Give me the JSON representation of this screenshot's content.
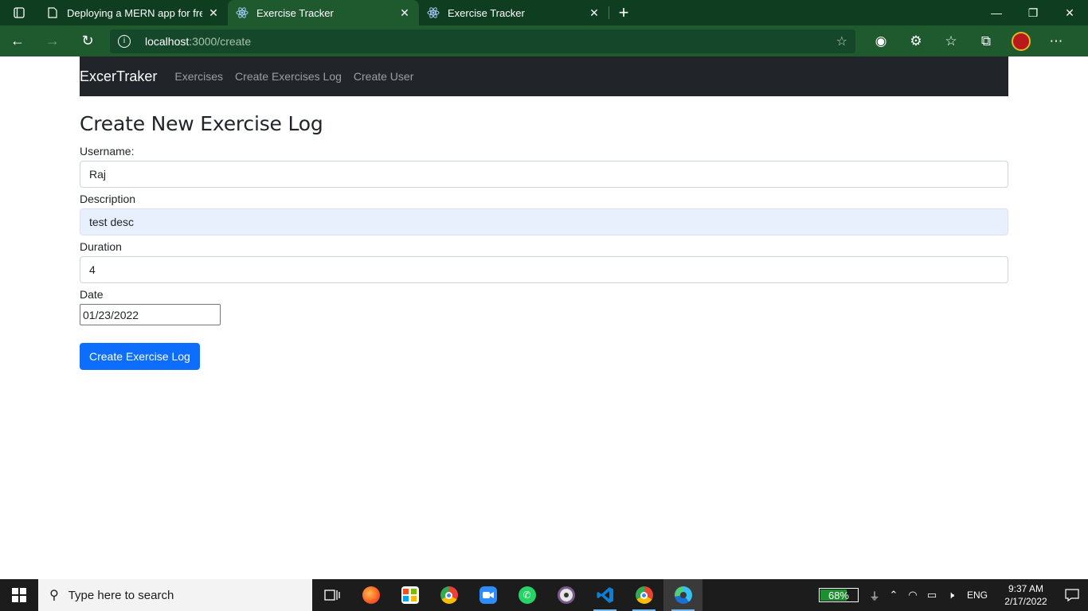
{
  "browser": {
    "tabs": [
      {
        "title": "Deploying a MERN app for free t",
        "active": false
      },
      {
        "title": "Exercise Tracker",
        "active": true
      },
      {
        "title": "Exercise Tracker",
        "active": false
      }
    ],
    "url_host": "localhost",
    "url_path": ":3000/create"
  },
  "app": {
    "brand": "ExcerTraker",
    "nav_links": [
      "Exercises",
      "Create Exercises Log",
      "Create User"
    ]
  },
  "form": {
    "title": "Create New Exercise Log",
    "username_label": "Username:",
    "username_value": "Raj",
    "description_label": "Description",
    "description_value": "test desc",
    "duration_label": "Duration",
    "duration_value": "4",
    "date_label": "Date",
    "date_value": "01/23/2022",
    "submit_label": "Create Exercise Log"
  },
  "taskbar": {
    "search_placeholder": "Type here to search",
    "battery_percent": "68%",
    "battery_level": 0.68,
    "language": "ENG",
    "time": "9:37 AM",
    "date": "2/17/2022"
  },
  "colors": {
    "navbar_bg": "#212529",
    "primary_button": "#0d6efd",
    "autofill_bg": "#e8f0fe",
    "browser_frame": "#1f5a2f"
  }
}
